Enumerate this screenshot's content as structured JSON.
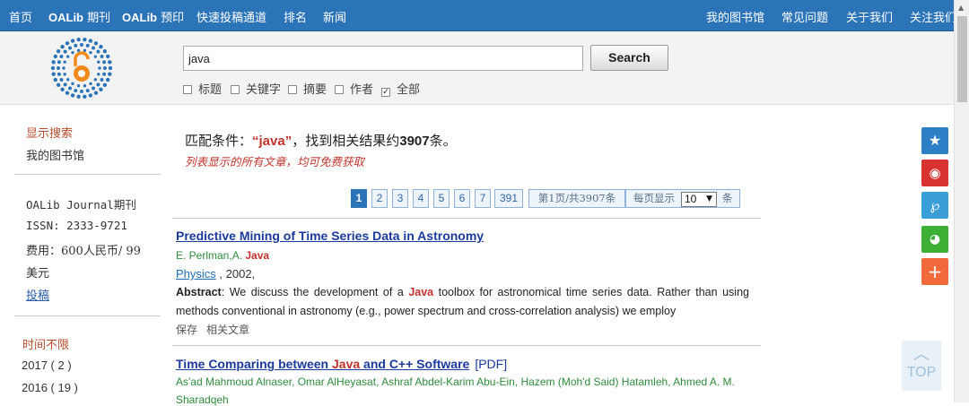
{
  "nav": {
    "home": "首页",
    "oalib_brand_1": "OALib",
    "journal": "期刊",
    "oalib_brand_2": "OALib",
    "preprint": "预印",
    "fast_submit": "快速投稿通道",
    "ranking": "排名",
    "news": "新闻",
    "my_library": "我的图书馆",
    "faq": "常见问题",
    "about_us": "关于我们",
    "follow_us": "关注我们"
  },
  "search": {
    "query": "java",
    "button_label": "Search",
    "filters": [
      {
        "label": "标题",
        "checked": false
      },
      {
        "label": "关键字",
        "checked": false
      },
      {
        "label": "摘要",
        "checked": false
      },
      {
        "label": "作者",
        "checked": false
      },
      {
        "label": "全部",
        "checked": true
      }
    ]
  },
  "sidebar": {
    "show_search": "显示搜索",
    "my_library": "我的图书馆",
    "journal_name": "OALib Journal期刊",
    "issn": "ISSN: 2333-9721",
    "fee_line1": "费用：600人民币/ 99",
    "fee_line2": "美元",
    "submit_link": "投稿",
    "time_heading": "时间不限",
    "years": [
      {
        "label": "2017 ( 2 )"
      },
      {
        "label": "2016 ( 19 )"
      }
    ]
  },
  "results_summary": {
    "prefix": "匹配条件：",
    "keyword": "“java”",
    "middle": "，找到相关结果约",
    "count": "3907",
    "suffix": "条。",
    "free_note": "列表显示的所有文章，均可免费获取"
  },
  "pagination": {
    "pages": [
      "1",
      "2",
      "3",
      "4",
      "5",
      "6",
      "7",
      "391"
    ],
    "current_page": "1",
    "page_info": "第1页/共3907条",
    "per_page_label": "每页显示",
    "per_page_value": "10",
    "per_page_suffix": "条"
  },
  "results": [
    {
      "title": "Predictive Mining of Time Series Data in Astronomy",
      "authors_plain": "E. Perlman,A. ",
      "authors_kw": "Java",
      "journal": "Physics",
      "year": " , 2002,",
      "abstract_label": "Abstract",
      "abstract_a": ": We discuss the development of a ",
      "abstract_kw": "Java",
      "abstract_b": " toolbox for astronomical time series data. Rather than using methods conventional in astronomy (e.g., power spectrum and cross-correlation analysis) we employ",
      "save": "保存",
      "related": "相关文章"
    },
    {
      "title_a": "Time Comparing between ",
      "title_kw": "Java",
      "title_b": " and C++ Software",
      "pdf": "[PDF]",
      "authors_line1": "As'ad Mahmoud Alnaser, Omar AlHeyasat, Ashraf Abdel-Karim Abu-Ein, Hazem (Moh'd Said) Hatamleh, Ahmed A. M.",
      "authors_line2": "Sharadqeh"
    }
  ],
  "share_icons": [
    "star-icon",
    "weibo-icon",
    "tencent-icon",
    "wechat-icon",
    "plus-icon"
  ],
  "share_colors": [
    "#2c7fc4",
    "#d8332f",
    "#3a9fd8",
    "#3cb034",
    "#f06a3b"
  ],
  "back_to_top": "TOP"
}
